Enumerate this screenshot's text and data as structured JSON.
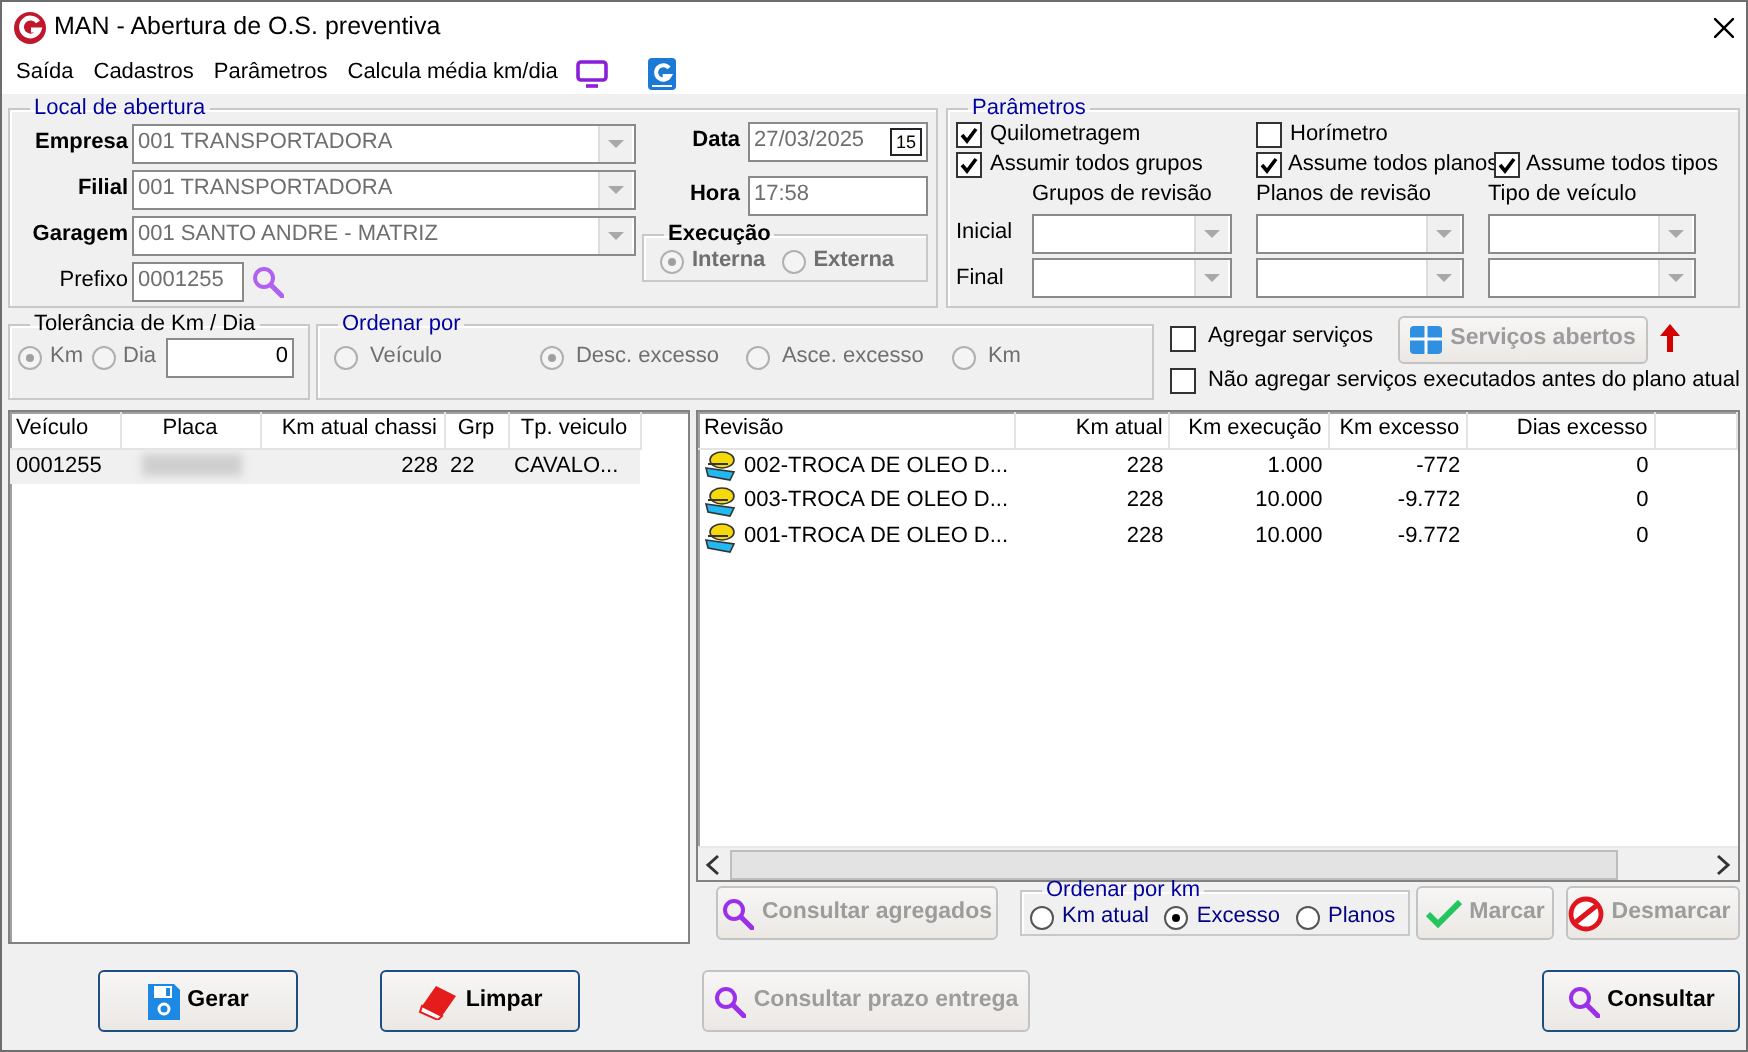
{
  "window": {
    "title": "MAN - Abertura de O.S. preventiva"
  },
  "menu": [
    {
      "label": "Saída"
    },
    {
      "label": "Cadastros"
    },
    {
      "label": "Parâmetros"
    },
    {
      "label": "Calcula média km/dia"
    }
  ],
  "local": {
    "legend": "Local de abertura",
    "fields": [
      {
        "label": "Empresa",
        "value": "001 TRANSPORTADORA",
        "kind": "combo",
        "required": true,
        "disabled": true
      },
      {
        "label": "Filial",
        "value": "001 TRANSPORTADORA",
        "kind": "combo",
        "required": true,
        "disabled": true
      },
      {
        "label": "Garagem",
        "value": "001 SANTO ANDRE - MATRIZ",
        "kind": "combo",
        "required": true,
        "disabled": true
      },
      {
        "label": "Prefixo",
        "value": "0001255",
        "kind": "lookup",
        "required": false,
        "disabled": true
      }
    ],
    "data": {
      "label": "Data",
      "value": "27/03/2025",
      "calendar": "15",
      "required": true,
      "disabled": true
    },
    "hora": {
      "label": "Hora",
      "value": "17:58",
      "required": true,
      "disabled": true
    },
    "execucao": {
      "legend": "Execução",
      "disabled": true,
      "options": [
        {
          "label": "Interna",
          "selected": true
        },
        {
          "label": "Externa",
          "selected": false
        }
      ]
    }
  },
  "parametros": {
    "legend": "Parâmetros",
    "checks": [
      {
        "label": "Quilometragem",
        "checked": true
      },
      {
        "label": "Horímetro",
        "checked": false
      },
      {
        "label": "Assumir todos grupos",
        "checked": true
      },
      {
        "label": "Assume todos planos",
        "checked": true
      },
      {
        "label": "Assume todos tipos",
        "checked": true
      }
    ],
    "columns": [
      "Grupos de revisão",
      "Planos de revisão",
      "Tipo de veículo"
    ],
    "rows": [
      "Inicial",
      "Final"
    ]
  },
  "tolerancia": {
    "legend": "Tolerância de Km / Dia",
    "disabled": true,
    "options": [
      {
        "label": "Km",
        "selected": true
      },
      {
        "label": "Dia",
        "selected": false
      }
    ],
    "value": "0"
  },
  "ordenar_por": {
    "legend": "Ordenar por",
    "disabled": true,
    "options": [
      {
        "label": "Veículo",
        "selected": false
      },
      {
        "label": "Desc. excesso",
        "selected": true
      },
      {
        "label": "Asce. excesso",
        "selected": false
      },
      {
        "label": "Km",
        "selected": false
      }
    ]
  },
  "agregar": {
    "checks": [
      {
        "label": "Agregar serviços",
        "checked": false
      },
      {
        "label": "Não agregar serviços executados antes do plano atual",
        "checked": false
      }
    ],
    "button": {
      "label": "Serviços abertos",
      "disabled": true
    }
  },
  "veiculos": {
    "columns": [
      "Veículo",
      "Placa",
      "Km atual chassi",
      "Grp",
      "Tp. veiculo"
    ],
    "rows": [
      {
        "veiculo": "0001255",
        "km_atual_chassi": "228",
        "grp": "22",
        "tp_veiculo": "CAVALO...",
        "selected": true
      }
    ]
  },
  "revisoes": {
    "columns": [
      "Revisão",
      "Km atual",
      "Km execução",
      "Km excesso",
      "Dias excesso"
    ],
    "rows": [
      {
        "revisao": "002-TROCA DE OLEO D...",
        "km_atual": "228",
        "km_execucao": "1.000",
        "km_excesso": "-772",
        "dias_excesso": "0"
      },
      {
        "revisao": "003-TROCA DE OLEO D...",
        "km_atual": "228",
        "km_execucao": "10.000",
        "km_excesso": "-9.772",
        "dias_excesso": "0"
      },
      {
        "revisao": "001-TROCA DE OLEO D...",
        "km_atual": "228",
        "km_execucao": "10.000",
        "km_excesso": "-9.772",
        "dias_excesso": "0"
      }
    ]
  },
  "grid_actions": {
    "consultar_agregados": {
      "label": "Consultar agregados",
      "disabled": true
    },
    "ordenar_por_km": {
      "legend": "Ordenar por km",
      "options": [
        {
          "label": "Km atual",
          "selected": false
        },
        {
          "label": "Excesso",
          "selected": true
        },
        {
          "label": "Planos",
          "selected": false
        }
      ]
    },
    "marcar": {
      "label": "Marcar",
      "disabled": true
    },
    "desmarcar": {
      "label": "Desmarcar",
      "disabled": true
    }
  },
  "footer": [
    {
      "label": "Gerar",
      "kind": "save",
      "disabled": false
    },
    {
      "label": "Limpar",
      "kind": "erase",
      "disabled": false
    },
    {
      "label": "Consultar prazo entrega",
      "kind": "search",
      "disabled": true
    },
    {
      "label": "Consultar",
      "kind": "search",
      "disabled": false
    }
  ]
}
